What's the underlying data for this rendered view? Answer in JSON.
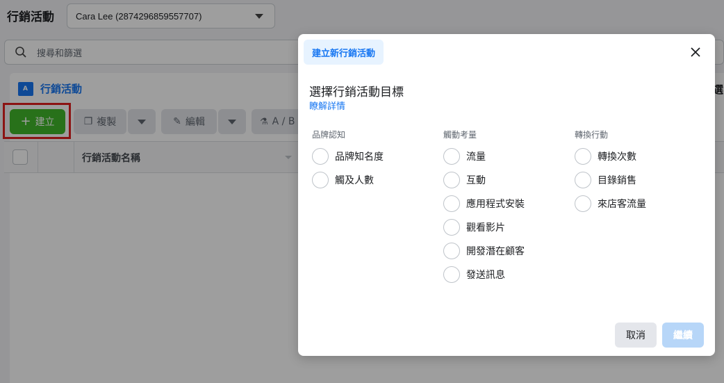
{
  "app": {
    "title": "行銷活動",
    "account_selected": "Cara Lee (2874296859557707)"
  },
  "search": {
    "placeholder": "搜尋和篩選"
  },
  "panel": {
    "heading": "行銷活動",
    "right_partial": "選"
  },
  "toolbar": {
    "create_label": "建立",
    "duplicate_label": "複製",
    "edit_label": "編輯",
    "ab_label": "A / B"
  },
  "table": {
    "col_name": "行銷活動名稱"
  },
  "modal": {
    "tab_label": "建立新行銷活動",
    "title": "選擇行銷活動目標",
    "learn_more": "瞭解詳情",
    "columns": [
      {
        "header": "品牌認知",
        "options": [
          "品牌知名度",
          "觸及人數"
        ]
      },
      {
        "header": "觸動考量",
        "options": [
          "流量",
          "互動",
          "應用程式安裝",
          "觀看影片",
          "開發潛在顧客",
          "發送訊息"
        ]
      },
      {
        "header": "轉換行動",
        "options": [
          "轉換次數",
          "目錄銷售",
          "來店客流量"
        ]
      }
    ],
    "cancel_label": "取消",
    "continue_label": "繼續"
  },
  "colors": {
    "accent": "#1877f2",
    "create_green": "#42b72a",
    "highlight_red": "#e02020",
    "continue_disabled": "#b7d6f8"
  }
}
